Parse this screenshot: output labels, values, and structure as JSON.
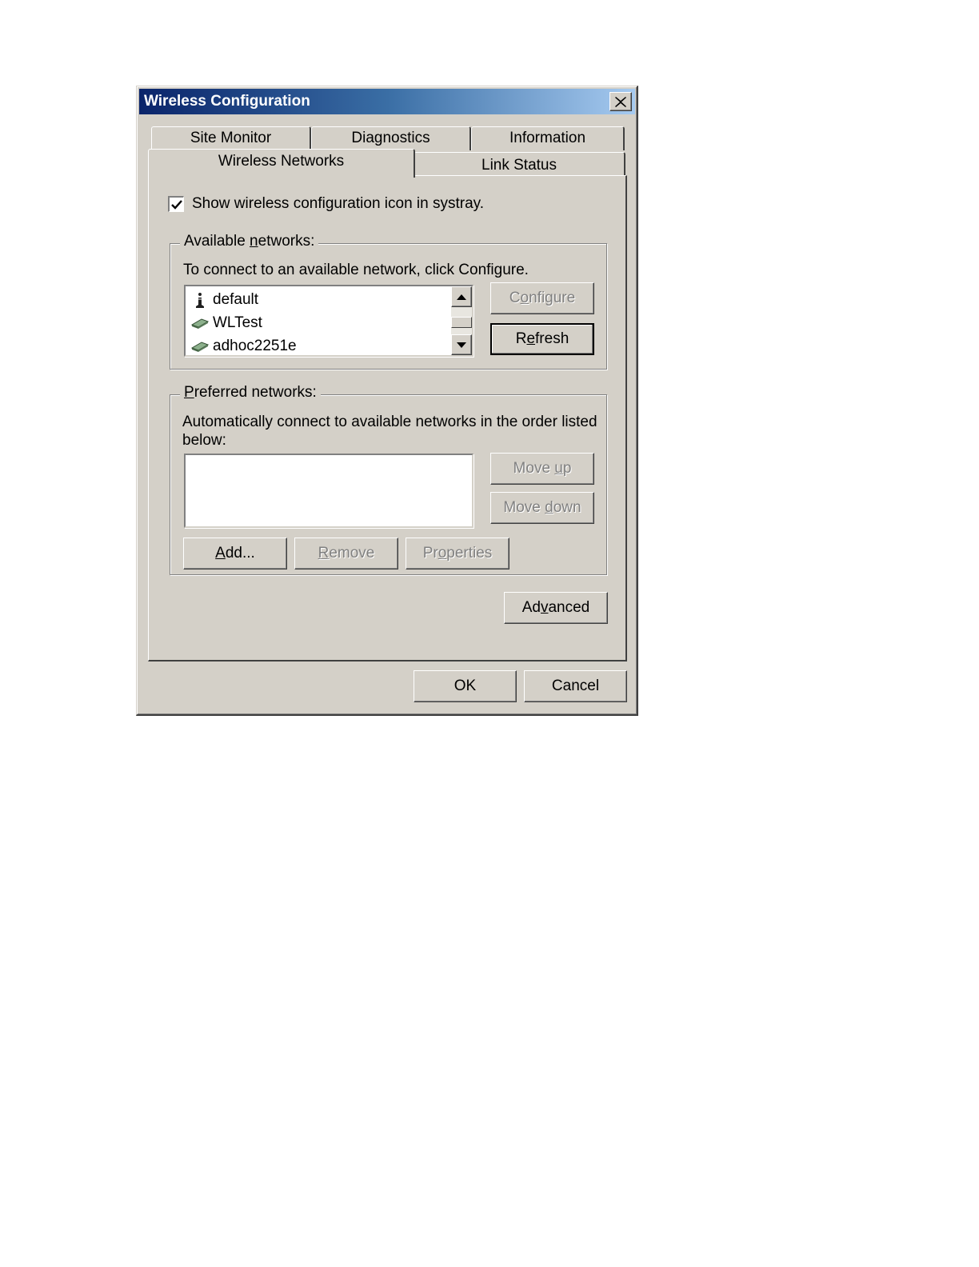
{
  "window": {
    "title": "Wireless Configuration"
  },
  "tabs": {
    "back_row": [
      {
        "label": "Site Monitor"
      },
      {
        "label": "Diagnostics"
      },
      {
        "label": "Information"
      }
    ],
    "front_row": [
      {
        "label": "Wireless Networks",
        "active": true
      },
      {
        "label": "Link Status",
        "active": false
      }
    ]
  },
  "systray_checkbox": {
    "label": "Show wireless configuration icon in systray.",
    "checked": true
  },
  "available": {
    "legend_pre": "Available ",
    "legend_underline": "n",
    "legend_post": "etworks:",
    "instruction": "To connect to an available network, click Configure.",
    "networks": [
      {
        "name": "default",
        "icon": "access-point-icon"
      },
      {
        "name": "WLTest",
        "icon": "wireless-card-icon"
      },
      {
        "name": "adhoc2251e",
        "icon": "wireless-card-icon"
      }
    ],
    "configure_pre": "C",
    "configure_underline": "o",
    "configure_post": "nfigure",
    "refresh_pre": "R",
    "refresh_underline": "e",
    "refresh_post": "fresh"
  },
  "preferred": {
    "legend_underline": "P",
    "legend_post": "referred networks:",
    "instruction_line1": "Automatically connect to available networks in the order listed",
    "instruction_line2": "below:",
    "moveup_pre": "Move ",
    "moveup_underline": "u",
    "moveup_post": "p",
    "movedown_pre": "Move ",
    "movedown_underline": "d",
    "movedown_post": "own",
    "add_underline": "A",
    "add_post": "dd...",
    "remove_underline": "R",
    "remove_post": "emove",
    "properties_pre": "Pr",
    "properties_underline": "o",
    "properties_post": "perties"
  },
  "advanced": {
    "pre": "Ad",
    "underline": "v",
    "post": "anced"
  },
  "footer": {
    "ok_label": "OK",
    "cancel_label": "Cancel"
  }
}
